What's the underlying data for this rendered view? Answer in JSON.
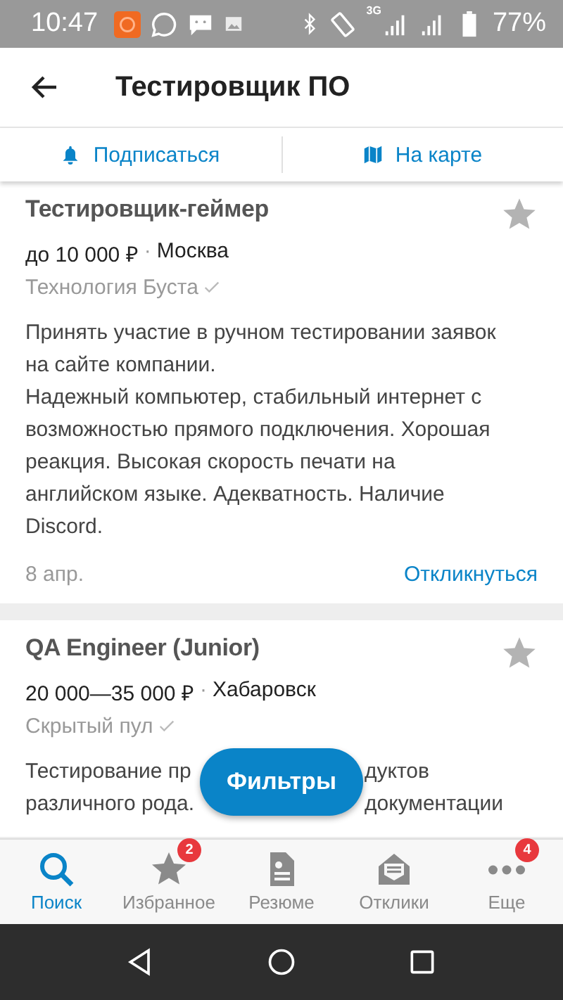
{
  "status_bar": {
    "time": "10:47",
    "network": "3G",
    "battery": "77%"
  },
  "header": {
    "title": "Тестировщик ПО"
  },
  "actions": [
    {
      "kind": "subscribe",
      "label": "Подписаться"
    },
    {
      "kind": "map",
      "label": "На карте"
    }
  ],
  "vacancies": [
    {
      "title": "Тестировщик-геймер",
      "salary": "до 10 000 ₽",
      "separator": "·",
      "city": "Москва",
      "company": "Технология Буста",
      "verified": true,
      "starred": false,
      "description_lines": [
        [
          "Принять участие в ручном тестировании заявок"
        ],
        [
          "на сайте компании."
        ],
        [
          "Надежный компьютер, стабильный интернет с"
        ],
        [
          "возможностью прямого подключения. Хорошая"
        ],
        [
          "реакция. Высокая скорость печати на"
        ],
        [
          "английском языке. Адекватность. Наличие"
        ],
        [
          "Discord."
        ]
      ],
      "date": "8 апр.",
      "action": "Откликнуться"
    },
    {
      "title": "QA Engineer (Junior)",
      "salary": "20 000—35 000 ₽",
      "separator": "·",
      "city": "Хабаровск",
      "company": "Скрытый пул",
      "verified": true,
      "starred": false,
      "description_lines": [
        [
          "Тестирование пр",
          "дуктов"
        ],
        [
          "различного рода.",
          "документации"
        ]
      ]
    }
  ],
  "filter_button": "Фильтры",
  "nav": [
    {
      "kind": "search",
      "label": "Поиск",
      "selected": true
    },
    {
      "kind": "favorites",
      "label": "Избранное",
      "selected": false,
      "badge": "2"
    },
    {
      "kind": "resume",
      "label": "Резюме",
      "selected": false
    },
    {
      "kind": "responses",
      "label": "Отклики",
      "selected": false
    },
    {
      "kind": "more",
      "label": "Еще",
      "selected": false,
      "badge": "4"
    }
  ]
}
